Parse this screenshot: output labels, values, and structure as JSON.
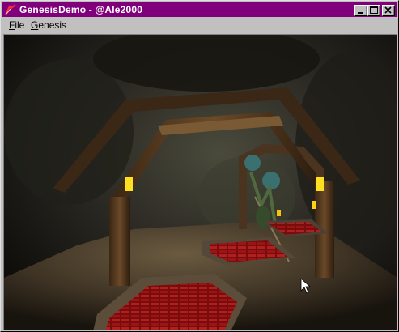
{
  "window": {
    "title": "GenesisDemo - @Ale2000",
    "app_icon": "genesis-app-icon",
    "controls": {
      "minimize_icon": "minimize-icon",
      "maximize_icon": "maximize-icon",
      "close_icon": "close-icon"
    }
  },
  "menubar": {
    "items": [
      {
        "accel": "F",
        "rest": "ile"
      },
      {
        "accel": "G",
        "rest": "enesis"
      }
    ]
  },
  "scene": {
    "description_icon": "3d-cave-scene",
    "cursor_icon": "mouse-pointer-icon"
  },
  "colors": {
    "titlebar": "#80007c",
    "chrome": "#c0c0c0",
    "lamp": "#ffe020",
    "pit_red": "#8c1010"
  }
}
